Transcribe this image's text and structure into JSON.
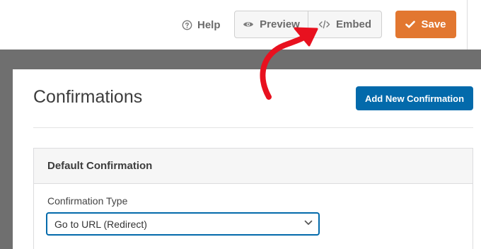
{
  "toolbar": {
    "help_label": "Help",
    "preview_label": "Preview",
    "embed_label": "Embed",
    "save_label": "Save"
  },
  "page": {
    "title": "Confirmations",
    "add_button_label": "Add New Confirmation"
  },
  "confirmation_card": {
    "header": "Default Confirmation",
    "type_label": "Confirmation Type",
    "type_value": "Go to URL (Redirect)"
  },
  "colors": {
    "save_orange": "#e27730",
    "primary_blue": "#036aab",
    "annotation_red": "#e8111f",
    "backdrop_gray": "#6f6f6f"
  },
  "icons": {
    "help": "help-circle-icon",
    "preview": "eye-icon",
    "embed": "code-icon",
    "save": "checkmark-icon",
    "select": "chevron-down-icon"
  }
}
